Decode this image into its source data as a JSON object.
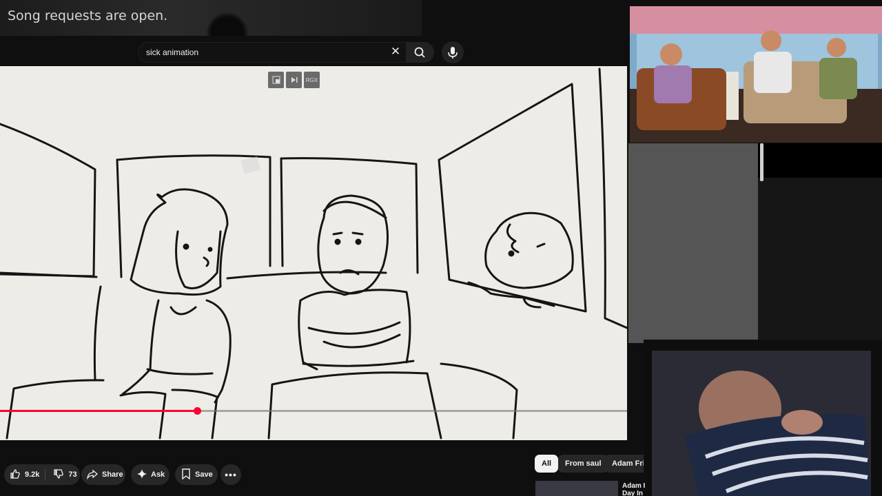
{
  "overlay": {
    "title": "Song requests are open."
  },
  "search": {
    "query": "sick animation",
    "clear_icon": "close-icon",
    "search_icon": "search-icon",
    "mic_icon": "mic-icon"
  },
  "player": {
    "controls": [
      "miniplayer-icon",
      "next-icon",
      "autoplay-label"
    ],
    "control_labels": {
      "rgx": "RGX"
    },
    "progress_fraction": 0.314
  },
  "actions": {
    "like_count": "9.2k",
    "dislike_count": "73",
    "share_label": "Share",
    "ask_label": "Ask",
    "save_label": "Save"
  },
  "filters": {
    "all": "All",
    "from": "From saul",
    "related": "Adam Frie"
  },
  "related": {
    "line1": "Adam I",
    "line2": "Day In"
  },
  "colors": {
    "accent": "#ff0033",
    "background": "#0f0f0f",
    "chip_active": "#f1f1f1"
  }
}
